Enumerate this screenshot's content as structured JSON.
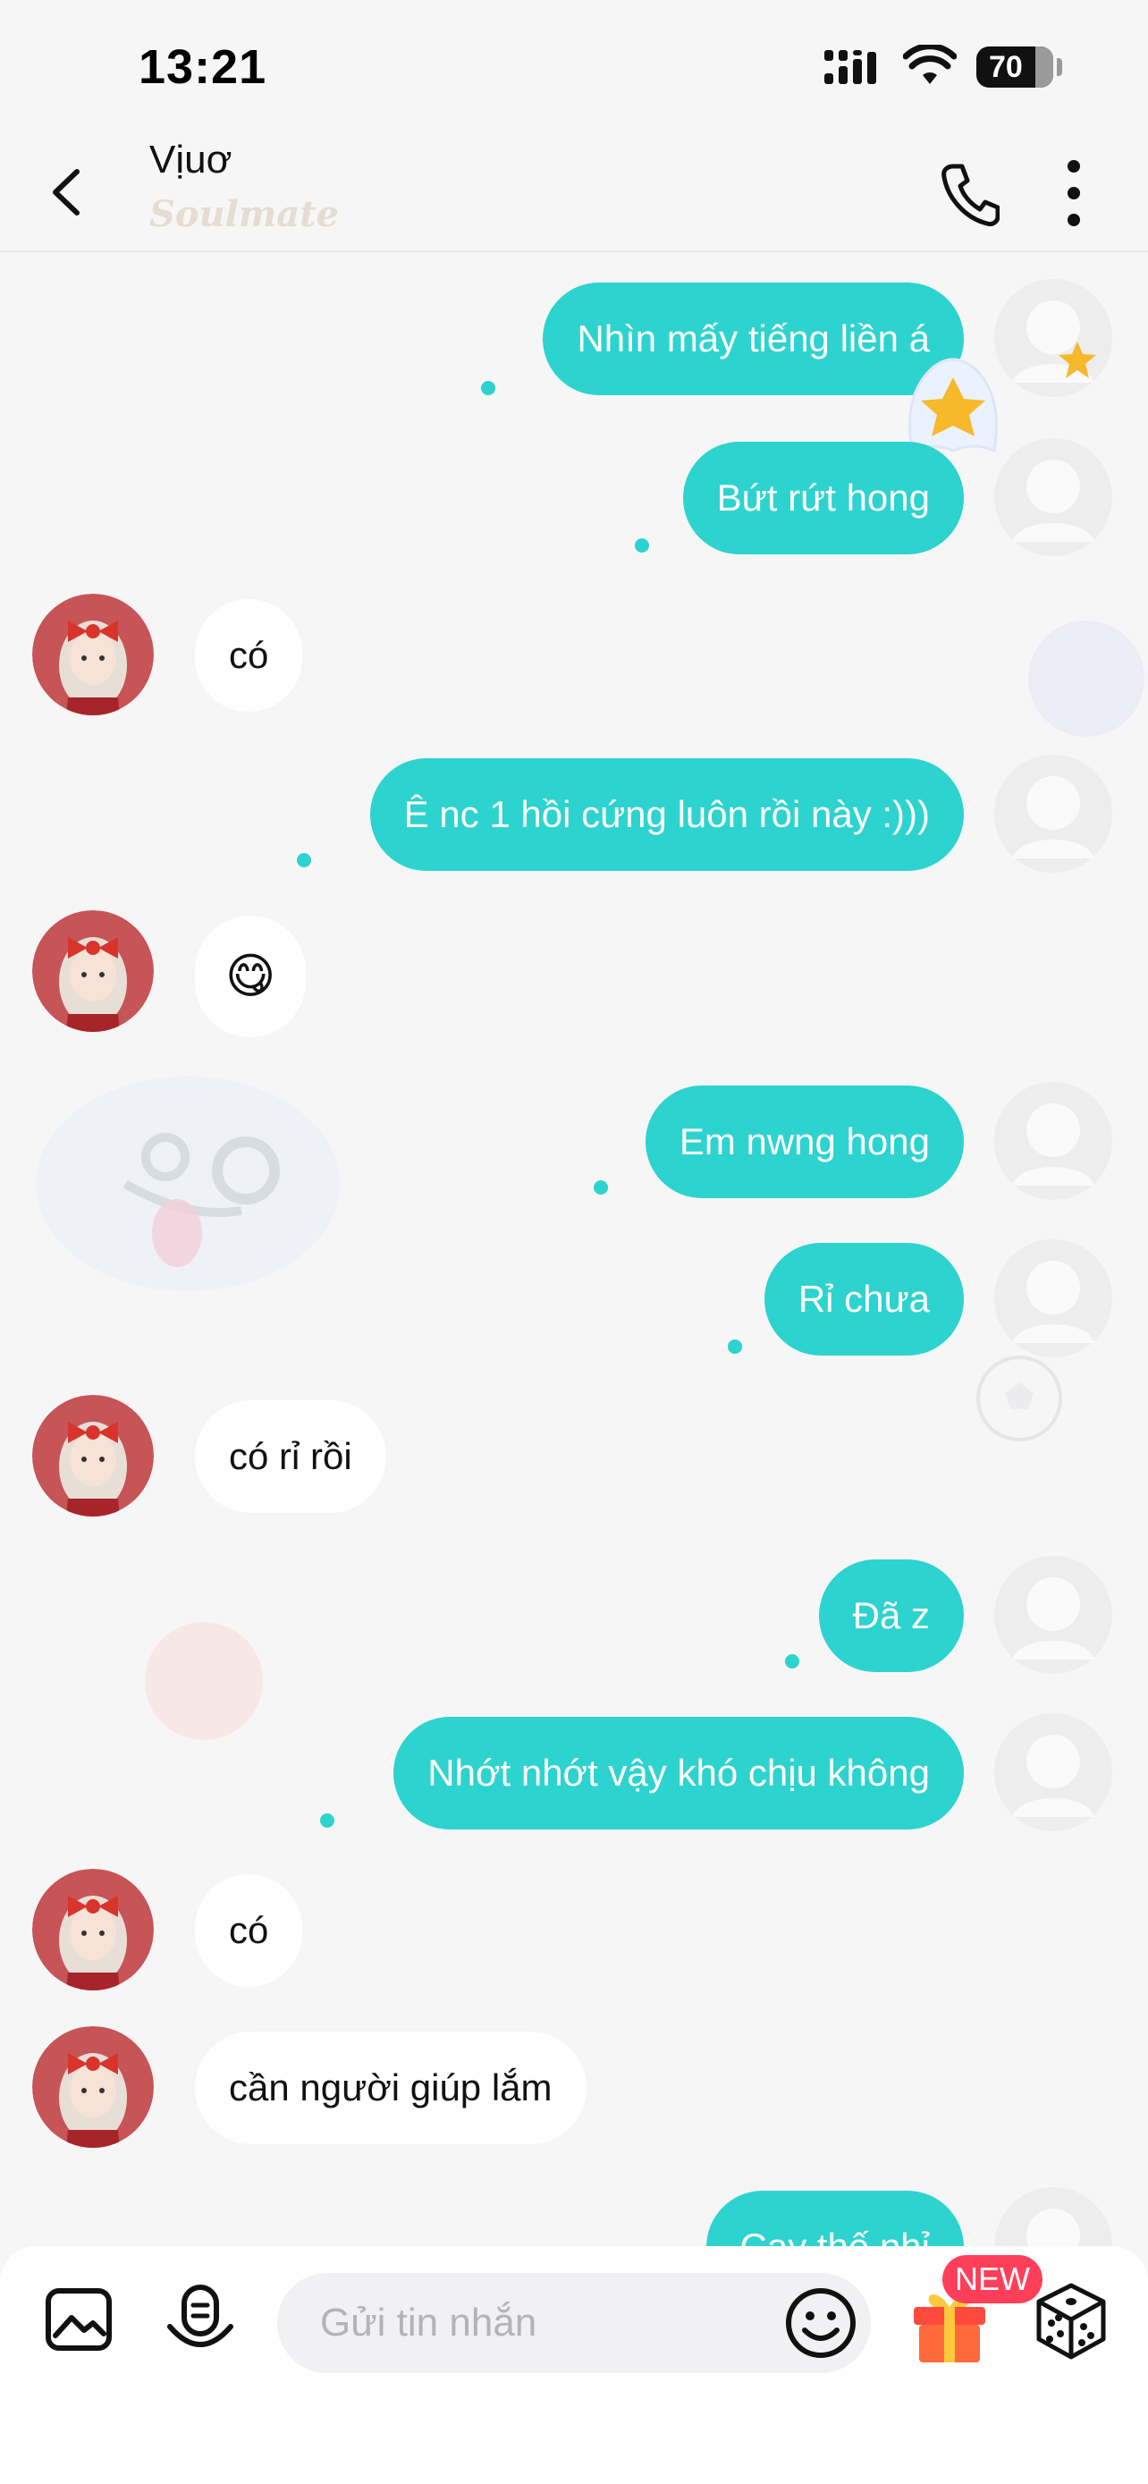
{
  "status_bar": {
    "time": "13:21",
    "battery_level": "70"
  },
  "header": {
    "contact_name": "Vịuơ",
    "relationship_badge": "Soulmate"
  },
  "colors": {
    "accent": "#2dd3cf",
    "incoming_bubble": "#ffffff",
    "background": "#f6f6f7",
    "avatar_red": "#d9342b",
    "badge_red": "#ff3f5a"
  },
  "messages": [
    {
      "direction": "out",
      "text": "Nhìn mấy tiếng liền á"
    },
    {
      "direction": "out",
      "text": "Bứt rứt hong"
    },
    {
      "direction": "in",
      "text": "có"
    },
    {
      "direction": "out",
      "text": "Ê nc 1 hồi cứng luôn rồi này :)))"
    },
    {
      "direction": "in",
      "text": "😋"
    },
    {
      "direction": "out",
      "text": "Em nwng hong"
    },
    {
      "direction": "out",
      "text": "Rỉ chưa"
    },
    {
      "direction": "in",
      "text": "có rỉ rồi"
    },
    {
      "direction": "out",
      "text": "Đã z"
    },
    {
      "direction": "out",
      "text": "Nhớt nhớt vậy khó chịu không"
    },
    {
      "direction": "in",
      "text": "có"
    },
    {
      "direction": "in",
      "text": "cần người giúp lắm"
    },
    {
      "direction": "out",
      "text": "Cay thế nhỉ"
    }
  ],
  "input_bar": {
    "placeholder": "Gửi tin nhắn",
    "new_badge": "NEW"
  },
  "icons": [
    "back-arrow-icon",
    "phone-icon",
    "more-vertical-icon",
    "image-icon",
    "voice-icon",
    "emoji-icon",
    "gift-icon",
    "dice-icon",
    "star-icon"
  ]
}
